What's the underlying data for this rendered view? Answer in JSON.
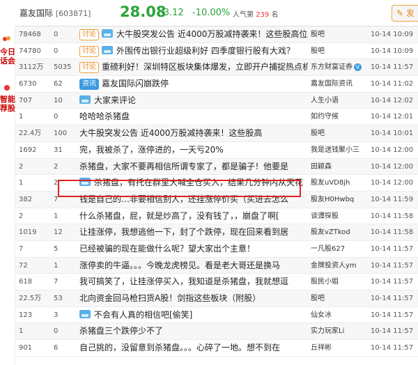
{
  "header": {
    "stock_name": "嘉友国际",
    "stock_code": "[603871]",
    "price": "28.08",
    "change": "-3.12",
    "change_pct": "-10.00%",
    "popularity_label": "人气第",
    "popularity_rank": "239",
    "popularity_unit": "名",
    "post_button": "发"
  },
  "sidebar": {
    "block1": "今日\n话会",
    "block2": "智能\n荐股"
  },
  "posts": [
    {
      "reads": "78468",
      "replies": "0",
      "tag": "讨论",
      "tag_type": "discuss",
      "pic": true,
      "title": "大牛股突发公告 近4000万股减持袭来！这些股高位减",
      "author": "股吧",
      "time": "10-14 10:09"
    },
    {
      "reads": "74780",
      "replies": "0",
      "tag": "讨论",
      "tag_type": "discuss",
      "pic": true,
      "title": "外围传出银行业超级利好 四季度银行股有大戏？",
      "author": "股吧",
      "time": "10-14 10:09"
    },
    {
      "reads": "3112万",
      "replies": "5035",
      "tag": "讨论",
      "tag_type": "discuss",
      "pic": false,
      "title": "重磅利好！深圳特区板块集体爆发，立即开户捕捉热点机",
      "author": "东方财富证券",
      "verified": true,
      "time": "10-14 11:57"
    },
    {
      "reads": "6730",
      "replies": "62",
      "tag": "资讯",
      "tag_type": "news",
      "pic": false,
      "title": "嘉友国际闪崩跌停",
      "author": "嘉友国际资讯",
      "time": "10-14 11:02"
    },
    {
      "reads": "707",
      "replies": "10",
      "tag": "",
      "tag_type": "",
      "pic": true,
      "title": "大家来评论",
      "author": "人生小语",
      "time": "10-14 12:02"
    },
    {
      "reads": "1",
      "replies": "0",
      "tag": "",
      "tag_type": "",
      "pic": false,
      "title": "哈哈哈杀猪盘",
      "author": "如约守候",
      "time": "10-14 12:01"
    },
    {
      "reads": "22.4万",
      "replies": "100",
      "tag": "",
      "tag_type": "",
      "pic": false,
      "title": "大牛股突发公告 近4000万股减持袭来！这些股高",
      "author": "股吧",
      "time": "10-14 10:01"
    },
    {
      "reads": "1692",
      "replies": "31",
      "tag": "",
      "tag_type": "",
      "pic": false,
      "title": "完，我被杀了，涨停进的，一天亏20%",
      "author": "我是送钱聚小三",
      "time": "10-14 12:00"
    },
    {
      "reads": "2",
      "replies": "2",
      "tag": "",
      "tag_type": "",
      "pic": false,
      "title": "杀猪盘，大家不要再相信所谓专家了，都是骗子！他要是",
      "author": "田颖森",
      "time": "10-14 12:00"
    },
    {
      "reads": "1",
      "replies": "2",
      "tag": "",
      "tag_type": "",
      "pic": true,
      "title": "杀猪盘，有托在群里大喊全仓买入，结果几分钟内从天花",
      "author": "股友uVD8jh",
      "time": "10-14 12:00"
    },
    {
      "reads": "382",
      "replies": "7",
      "tag": "",
      "tag_type": "",
      "pic": false,
      "title": "钱是自己的…非要相信别人，还挂涨停价买（买进去怎么",
      "author": "股友H0Hwbq",
      "time": "10-14 11:59"
    },
    {
      "reads": "2",
      "replies": "1",
      "tag": "",
      "tag_type": "",
      "pic": false,
      "title": "什么杀猪盘，屁，就是炒高了，没有钱了，，崩盘了啊[",
      "author": "谈谭探股",
      "time": "10-14 11:58"
    },
    {
      "reads": "1019",
      "replies": "12",
      "tag": "",
      "tag_type": "",
      "pic": false,
      "title": "让挂涨停，我想逃他一下，封了个跌停，现在回来看到居",
      "author": "股友vZTkod",
      "time": "10-14 11:58"
    },
    {
      "reads": "7",
      "replies": "5",
      "tag": "",
      "tag_type": "",
      "pic": false,
      "title": "已经被骗的现在能做什么呢？望大家出个主意！",
      "author": "一凡股627",
      "time": "10-14 11:57"
    },
    {
      "reads": "72",
      "replies": "1",
      "tag": "",
      "tag_type": "",
      "pic": false,
      "title": "涨停卖的牛逼。。。今晚龙虎榜见。看是老大哥还是换马",
      "author": "金牌投资人ym",
      "time": "10-14 11:57"
    },
    {
      "reads": "618",
      "replies": "7",
      "tag": "",
      "tag_type": "",
      "pic": false,
      "title": "我可搞笑了，让挂涨停买入，我知道是杀猪盘，我就想逗",
      "author": "股民小姐",
      "time": "10-14 11:57"
    },
    {
      "reads": "22.5万",
      "replies": "53",
      "tag": "",
      "tag_type": "",
      "pic": false,
      "title": "北向资金回马枪扫货A股！剑指这些板块（附股）",
      "author": "股吧",
      "time": "10-14 11:57"
    },
    {
      "reads": "123",
      "replies": "3",
      "tag": "",
      "tag_type": "",
      "pic": true,
      "title": "不会有人真的相信吧[偷笑]",
      "author": "仙女冰",
      "time": "10-14 11:57"
    },
    {
      "reads": "1",
      "replies": "0",
      "tag": "",
      "tag_type": "",
      "pic": false,
      "title": "杀猪盘三个跌停少不了",
      "author": "实力玩家Li",
      "time": "10-14 11:57"
    },
    {
      "reads": "901",
      "replies": "6",
      "tag": "",
      "tag_type": "",
      "pic": false,
      "title": "自己挑的，没留意到杀猪盘。。。心碎了一地。想不到在",
      "author": "丘祥彬",
      "time": "10-14 11:57"
    }
  ]
}
